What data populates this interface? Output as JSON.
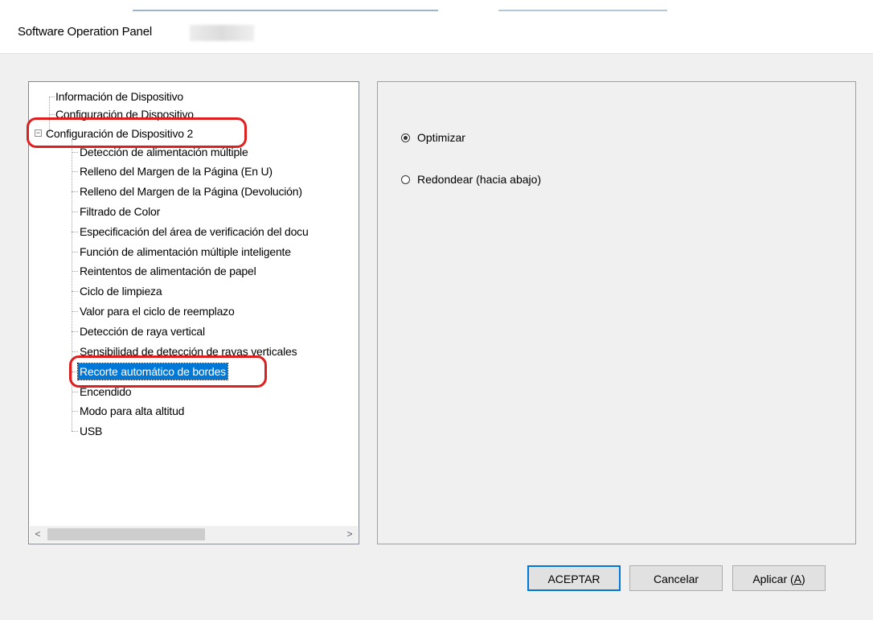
{
  "window": {
    "title": "Software Operation Panel"
  },
  "tree": {
    "items": [
      {
        "label": "Información de Dispositivo"
      },
      {
        "label": "Configuración de Dispositivo"
      },
      {
        "label": "Configuración de Dispositivo 2",
        "expanded": true
      },
      {
        "label": "Detección de alimentación múltiple"
      },
      {
        "label": "Relleno del Margen de la Página (En U)"
      },
      {
        "label": "Relleno del Margen de la Página (Devolución)"
      },
      {
        "label": "Filtrado de Color"
      },
      {
        "label": "Especificación del área de verificación del docu"
      },
      {
        "label": "Función de alimentación múltiple inteligente"
      },
      {
        "label": "Reintentos de alimentación de papel"
      },
      {
        "label": "Ciclo de limpieza"
      },
      {
        "label": "Valor para el ciclo de reemplazo"
      },
      {
        "label": "Detección de raya vertical"
      },
      {
        "label": "Sensibilidad de detección de rayas verticales"
      },
      {
        "label": "Recorte automático de bordes",
        "selected": true
      },
      {
        "label": "Encendido"
      },
      {
        "label": "Modo para alta altitud"
      },
      {
        "label": "USB"
      }
    ],
    "expander_symbol": "−",
    "scroll_left": "<",
    "scroll_right": ">"
  },
  "options": {
    "radio1": {
      "label": "Optimizar",
      "checked": true
    },
    "radio2": {
      "label": "Redondear (hacia abajo)",
      "checked": false
    }
  },
  "buttons": {
    "ok": "ACEPTAR",
    "cancel": "Cancelar",
    "apply_prefix": "Aplicar (",
    "apply_key": "A",
    "apply_suffix": ")"
  },
  "colors": {
    "selection": "#0078d7",
    "annotation_red": "#e01e1e"
  }
}
